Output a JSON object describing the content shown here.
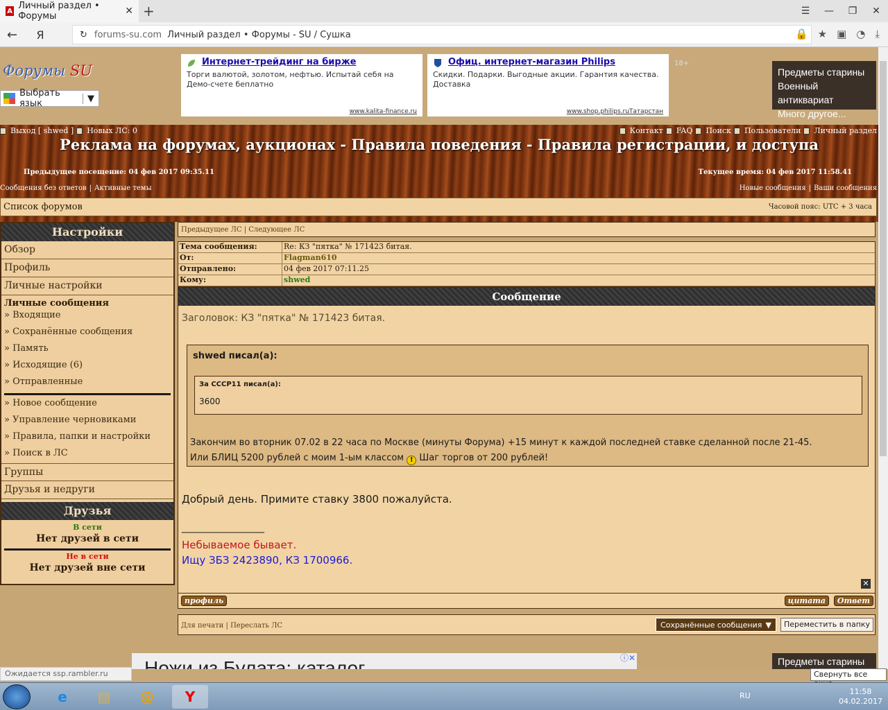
{
  "browser": {
    "tab_title": "Личный раздел • Форумы",
    "domain": "forums-su.com",
    "page_title": "Личный раздел • Форумы - SU / Сушка",
    "yandex": "Я"
  },
  "header": {
    "logo_main": "Форумы",
    "logo_su": "SU",
    "lang_label": "Выбрать язык",
    "age": "18+",
    "ad1": {
      "title": "Интернет-трейдинг на бирже",
      "text": "Торги валютой, золотом, нефтью. Испытай себя на Демо-счете беплатно",
      "src": "www.kalita-finance.ru"
    },
    "ad2": {
      "title": "Офиц. интернет-магазин Philips",
      "text": "Скидки. Подарки. Выгодные акции. Гарантия качества. Доставка",
      "src": "www.shop.philips.ruТатарстан"
    },
    "banner": [
      "Предметы старины",
      "Военный антиквариат",
      "Много другое..."
    ]
  },
  "topnav": {
    "logout": "Выход [ shwed ]",
    "new_pm": "Новых ЛС: 0",
    "contact": "Контакт",
    "faq": "FAQ",
    "search": "Поиск",
    "users": "Пользователи",
    "personal": "Личный раздел",
    "title": "Реклама на форумах, аукционах - Правила поведения - Правила регистрации, и доступа",
    "prev_visit": "Предыдущее посещение: 04 фев 2017 09:35.11",
    "cur_time": "Текущее время: 04 фев 2017 11:58.41",
    "no_replies": "Сообщения без ответов",
    "active": "Активные темы",
    "new_msgs": "Новые сообщения",
    "your_msgs": "Ваши сообщения"
  },
  "forumlist": {
    "label": "Список форумов",
    "tz": "Часовой пояс: UTC + 3 часа"
  },
  "sidebar": {
    "title": "Настройки",
    "overview": "Обзор",
    "profile": "Профиль",
    "personal": "Личные настройки",
    "pm": "Личные сообщения",
    "items": [
      "» Входящие",
      "» Сохранённые сообщения",
      "» Память",
      "» Исходящие (6)",
      "» Отправленные"
    ],
    "items2": [
      "» Новое сообщение",
      "» Управление черновиками",
      "» Правила, папки и настройки",
      "» Поиск в ЛС"
    ],
    "groups": "Группы",
    "friends_foes": "Друзья и недруги",
    "friends": "Друзья",
    "online": "В сети",
    "no_online": "Нет друзей в сети",
    "offline": "Не в сети",
    "no_offline": "Нет друзей вне сети"
  },
  "message": {
    "prev": "Предыдущее ЛС",
    "next": "Следующее ЛС",
    "meta": [
      {
        "k": "Тема сообщения:",
        "v": "Re: КЗ \"пятка\" № 171423 битая."
      },
      {
        "k": "От:",
        "v": "Flagman610"
      },
      {
        "k": "Отправлено:",
        "v": "04 фев 2017 07:11.25"
      },
      {
        "k": "Кому:",
        "v": "shwed"
      }
    ],
    "header": "Сообщение",
    "subject": "Заголовок: КЗ \"пятка\" № 171423 битая.",
    "q1_head": "shwed писал(а):",
    "q2_head": "За СССР11 писал(а):",
    "q2_val": "3600",
    "q1_line1": "Закончим во вторник 07.02 в 22 часа по Москве (минуты Форума) +15 минут к каждой последней ставке сделанной после 21-45.",
    "q1_line2a": "Или БЛИЦ 5200 рублей с моим 1-ым классом",
    "q1_line2b": "Шаг торгов от 200 рублей!",
    "greeting": "Добрый день. Примите ставку 3800 пожалуйста.",
    "sigline": "_________________",
    "sig1": "Небываемое бывает.",
    "sig2": "Ищу ЗБЗ 2423890, КЗ 1700966.",
    "profile_btn": "профиль",
    "quote_btn": "цитата",
    "reply_btn": "Ответ",
    "print": "Для печати",
    "forward": "Переслать ЛС",
    "folder": "Сохранённые сообщения",
    "move": "Переместить в папку"
  },
  "bottom": {
    "ad": "Ножи из Булата: каталог",
    "status": "Ожидается ssp.rambler.ru",
    "tooltip": "Свернуть все окна",
    "banner": "Предметы старины Военн",
    "lang": "RU",
    "time": "11:58",
    "date": "04.02.2017"
  }
}
